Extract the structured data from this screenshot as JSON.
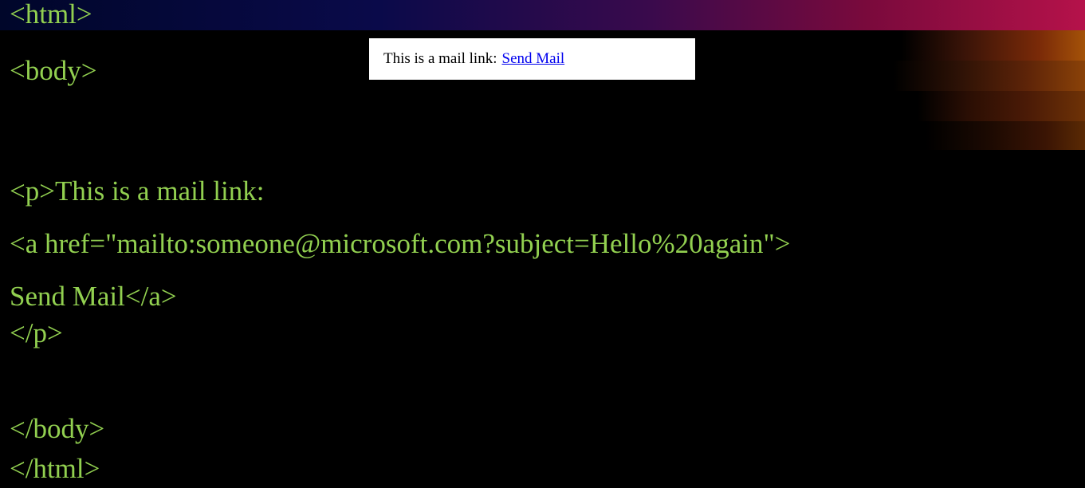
{
  "code_lines": [
    "<html>",
    "<body>",
    "<p>This is a mail link:",
    "<a href=\"mailto:someone@microsoft.com?subject=Hello%20again\">",
    "Send Mail</a>",
    "</p>",
    "</body>",
    "</html>"
  ],
  "preview": {
    "text": "This is a mail link:",
    "link_text": "Send Mail"
  },
  "colors": {
    "background": "#000000",
    "code_text": "#92d050",
    "link": "#0000ee",
    "preview_background": "#ffffff"
  }
}
